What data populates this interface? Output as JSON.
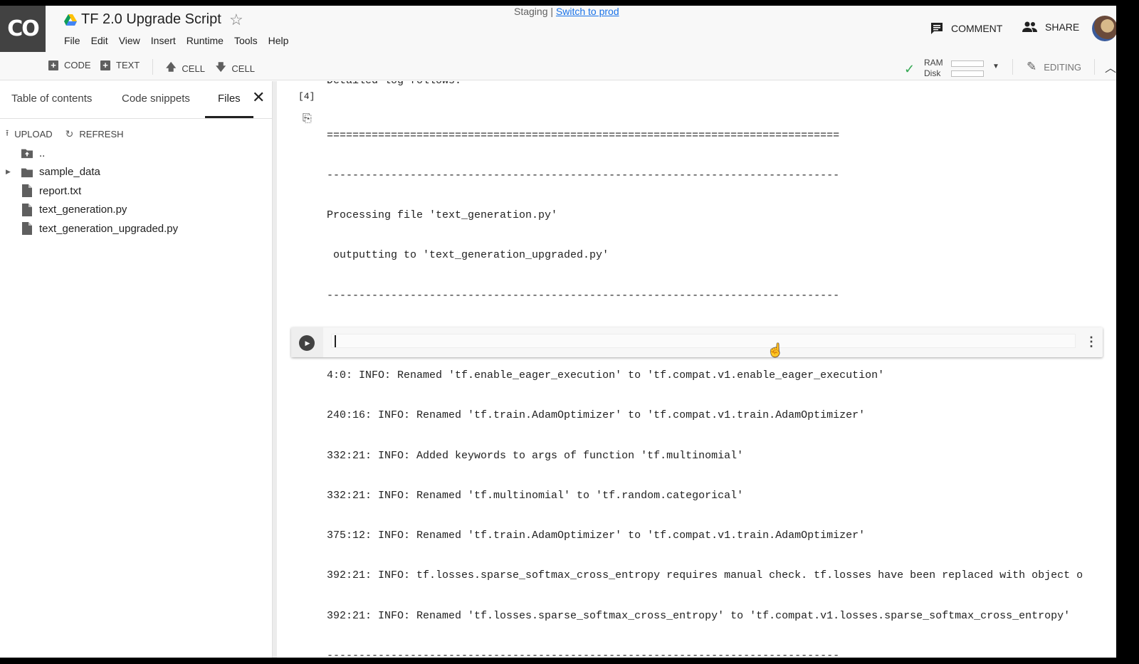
{
  "app": {
    "logo": "CO",
    "title": "TF 2.0 Upgrade Script",
    "staging_text": "Staging | ",
    "switch_link": "Switch to prod"
  },
  "menu": [
    "File",
    "Edit",
    "View",
    "Insert",
    "Runtime",
    "Tools",
    "Help"
  ],
  "header_actions": {
    "comment": "COMMENT",
    "share": "SHARE"
  },
  "toolbar": {
    "code": "CODE",
    "text": "TEXT",
    "cell_up": "CELL",
    "cell_down": "CELL",
    "ram": "RAM",
    "disk": "Disk",
    "ram_usage": 0.0,
    "disk_usage": 0.0,
    "editing": "EDITING"
  },
  "sidebar": {
    "tabs": [
      "Table of contents",
      "Code snippets",
      "Files"
    ],
    "active_tab": "Files",
    "upload": "UPLOAD",
    "refresh": "REFRESH",
    "files": [
      {
        "name": "..",
        "type": "folder-up"
      },
      {
        "name": "sample_data",
        "type": "folder"
      },
      {
        "name": "report.txt",
        "type": "file"
      },
      {
        "name": "text_generation.py",
        "type": "file"
      },
      {
        "name": "text_generation_upgraded.py",
        "type": "file"
      }
    ]
  },
  "notebook": {
    "partial_line": "Detailed log follows:",
    "exec_count": "[4]",
    "output_lines": [
      "================================================================================",
      "--------------------------------------------------------------------------------",
      "Processing file 'text_generation.py'",
      " outputting to 'text_generation_upgraded.py'",
      "--------------------------------------------------------------------------------",
      "",
      "4:0: INFO: Renamed 'tf.enable_eager_execution' to 'tf.compat.v1.enable_eager_execution'",
      "240:16: INFO: Renamed 'tf.train.AdamOptimizer' to 'tf.compat.v1.train.AdamOptimizer'",
      "332:21: INFO: Added keywords to args of function 'tf.multinomial'",
      "332:21: INFO: Renamed 'tf.multinomial' to 'tf.random.categorical'",
      "375:12: INFO: Renamed 'tf.train.AdamOptimizer' to 'tf.compat.v1.train.AdamOptimizer'",
      "392:21: INFO: tf.losses.sparse_softmax_cross_entropy requires manual check. tf.losses have been replaced with object o",
      "392:21: INFO: Renamed 'tf.losses.sparse_softmax_cross_entropy' to 'tf.compat.v1.losses.sparse_softmax_cross_entropy'",
      "--------------------------------------------------------------------------------"
    ],
    "empty_cell_code": ""
  },
  "colors": {
    "logo_bg": "#424242",
    "link": "#1a73e8",
    "check": "#34a853"
  }
}
